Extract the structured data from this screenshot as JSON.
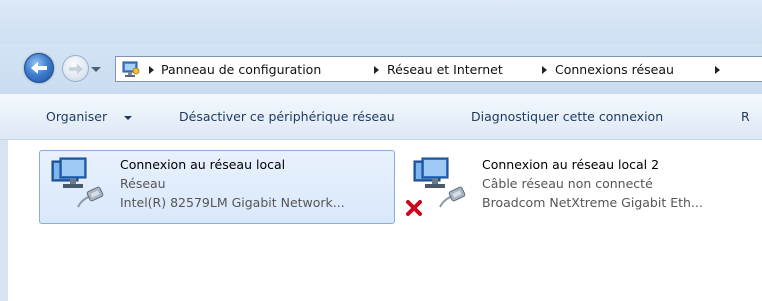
{
  "address": {
    "crumbs": [
      "Panneau de configuration",
      "Réseau et Internet",
      "Connexions réseau"
    ]
  },
  "toolbar": {
    "organize_label": "Organiser",
    "disable_label": "Désactiver ce périphérique réseau",
    "diagnose_label": "Diagnostiquer cette connexion",
    "overflow_label": "R"
  },
  "connections": [
    {
      "name": "Connexion au réseau local",
      "status": "Réseau",
      "device": "Intel(R) 82579LM Gigabit Network...",
      "selected": true,
      "disconnected": false
    },
    {
      "name": "Connexion au réseau local 2",
      "status": "Câble réseau non connecté",
      "device": "Broadcom NetXtreme Gigabit Eth...",
      "selected": false,
      "disconnected": true
    }
  ],
  "icons": {
    "back": "back-arrow-icon",
    "forward": "forward-arrow-icon",
    "control_panel": "control-panel-icon",
    "network_adapter": "network-adapter-icon",
    "disconnected": "red-x-icon"
  },
  "colors": {
    "selection_bg": "#d9e8fb",
    "selection_border": "#84acdd",
    "toolbar_text": "#1e3a5f",
    "error_red": "#d0021b"
  }
}
